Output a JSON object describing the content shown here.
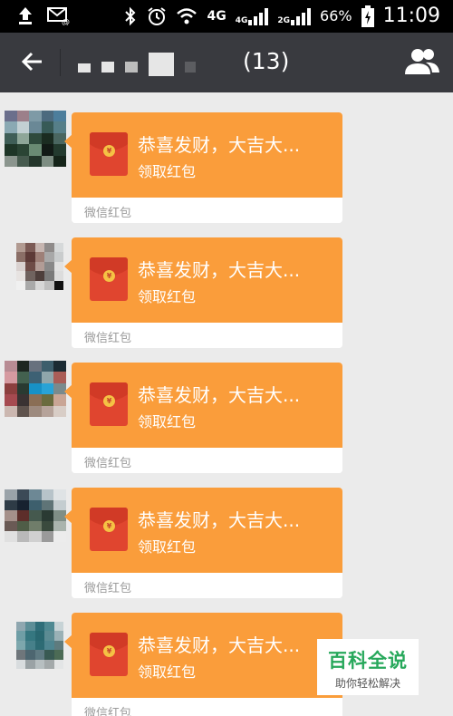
{
  "status_bar": {
    "network": "4G",
    "sim1_label": "4G",
    "sim2_label": "2G",
    "battery": "66%",
    "time": "11:09"
  },
  "header": {
    "member_count": "(13)"
  },
  "messages": [
    {
      "greeting": "恭喜发财，大吉大...",
      "action": "领取红包",
      "source": "微信红包"
    },
    {
      "greeting": "恭喜发财，大吉大...",
      "action": "领取红包",
      "source": "微信红包"
    },
    {
      "greeting": "恭喜发财，大吉大...",
      "action": "领取红包",
      "source": "微信红包"
    },
    {
      "greeting": "恭喜发财，大吉大...",
      "action": "领取红包",
      "source": "微信红包"
    },
    {
      "greeting": "恭喜发财，大吉大...",
      "action": "领取红包",
      "source": "微信红包"
    }
  ],
  "coin_symbol": "¥",
  "watermark": {
    "title": "百科全说",
    "subtitle": "助你轻松解决"
  },
  "colors": {
    "title_bar": "#393a3f",
    "red_packet": "#fa9d3b",
    "envelope": "#e0452f",
    "background": "#ebebeb",
    "watermark_green": "#27a85b"
  }
}
